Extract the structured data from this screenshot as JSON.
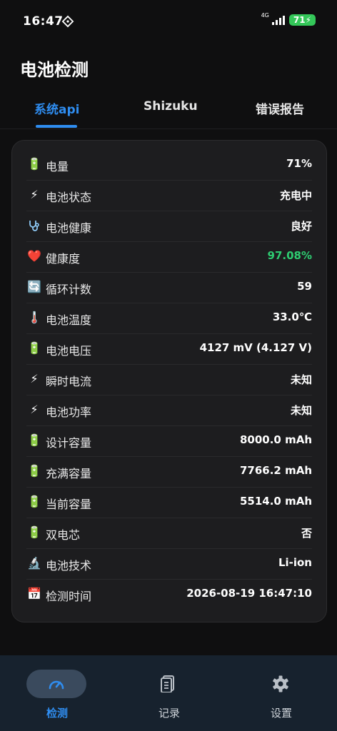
{
  "status_bar": {
    "time": "16:47",
    "network": "4G",
    "battery": "71"
  },
  "page_title": "电池检测",
  "tabs": [
    {
      "label": "系统api",
      "active": true
    },
    {
      "label": "Shizuku",
      "active": false
    },
    {
      "label": "错误报告",
      "active": false
    }
  ],
  "rows": [
    {
      "icon": "battery-icon",
      "label": "电量",
      "value": "71%"
    },
    {
      "icon": "lightning-icon",
      "label": "电池状态",
      "value": "充电中"
    },
    {
      "icon": "stethoscope-icon",
      "label": "电池健康",
      "value": "良好"
    },
    {
      "icon": "heart-icon",
      "label": "健康度",
      "value": "97.08%",
      "value_color": "#2ecc71"
    },
    {
      "icon": "cycle-icon",
      "label": "循环计数",
      "value": "59"
    },
    {
      "icon": "thermometer-icon",
      "label": "电池温度",
      "value": "33.0℃"
    },
    {
      "icon": "battery-icon",
      "label": "电池电压",
      "value": "4127 mV (4.127 V)"
    },
    {
      "icon": "lightning-icon",
      "label": "瞬时电流",
      "value": "未知"
    },
    {
      "icon": "lightning-icon",
      "label": "电池功率",
      "value": "未知"
    },
    {
      "icon": "battery-icon",
      "label": "设计容量",
      "value": "8000.0 mAh"
    },
    {
      "icon": "battery-icon",
      "label": "充满容量",
      "value": "7766.2 mAh"
    },
    {
      "icon": "battery-icon",
      "label": "当前容量",
      "value": "5514.0 mAh"
    },
    {
      "icon": "battery-icon",
      "label": "双电芯",
      "value": "否"
    },
    {
      "icon": "microscope-icon",
      "label": "电池技术",
      "value": "Li-ion"
    },
    {
      "icon": "calendar-icon",
      "label": "检测时间",
      "value": "2026-08-19 16:47:10"
    }
  ],
  "bottom_nav": [
    {
      "icon": "gauge-icon",
      "label": "检测",
      "active": true
    },
    {
      "icon": "document-icon",
      "label": "记录",
      "active": false
    },
    {
      "icon": "gear-icon",
      "label": "设置",
      "active": false
    }
  ],
  "colors": {
    "accent": "#2f8df0",
    "good": "#2ecc71",
    "background": "#0f0f10",
    "card": "#1d1d1f"
  }
}
